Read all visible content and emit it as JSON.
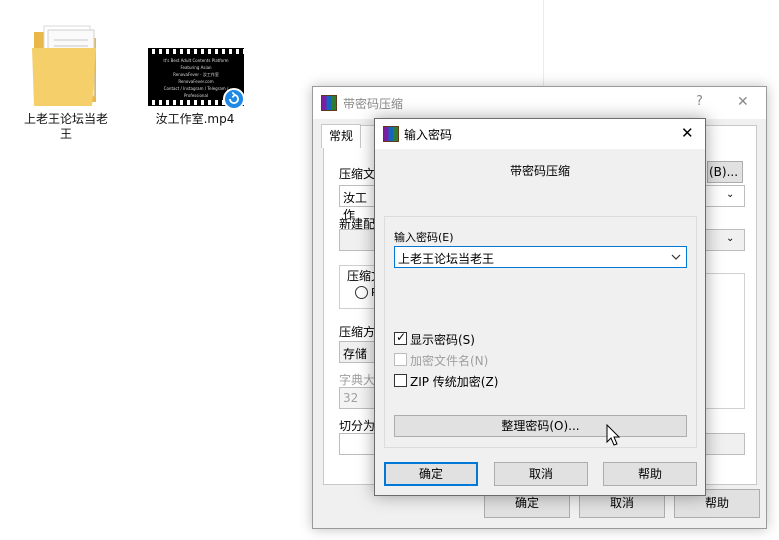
{
  "desktop": {
    "folder_label": "上老王论坛当老王",
    "video_label": "汝工作室.mp4",
    "video_thumb_lines": [
      "It's Best Adult Contents Platform Featuring Asian",
      "RenovaFever · 汝工作室",
      "RenovaFever.com",
      "Contact / Instagram / Telegram / Professional"
    ]
  },
  "back_dialog": {
    "title": "带密码压缩",
    "help_glyph": "?",
    "close_glyph": "✕",
    "tab_general": "常规",
    "label_archive": "压缩文",
    "archive_value": "汝工作",
    "browse_suffix": "(B)...",
    "label_profile": "新建配",
    "label_format": "压缩文",
    "radio_partial": "R",
    "label_method": "压缩方",
    "method_value": "存储",
    "label_dict": "字典大",
    "dict_value": "32",
    "label_split": "切分为",
    "btn_ok": "确定",
    "btn_cancel": "取消",
    "btn_help": "帮助"
  },
  "password_dialog": {
    "title": "输入密码",
    "close_glyph": "✕",
    "heading": "带密码压缩",
    "label_password": "输入密码(E)",
    "password_value": "上老王论坛当老王",
    "chk_show_password": "显示密码(S)",
    "chk_encrypt_names": "加密文件名(N)",
    "chk_zip_legacy": "ZIP 传统加密(Z)",
    "btn_organize": "整理密码(O)...",
    "btn_ok": "确定",
    "btn_cancel": "取消",
    "btn_help": "帮助",
    "show_password_checked": true,
    "encrypt_names_checked": false,
    "zip_legacy_checked": false
  },
  "colors": {
    "accent": "#0078d7",
    "dialog_bg": "#f0f0f0",
    "button_bg": "#e1e1e1"
  }
}
